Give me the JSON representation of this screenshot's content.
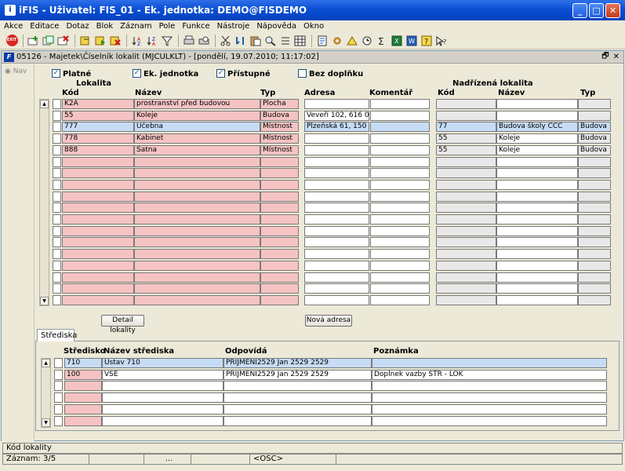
{
  "window": {
    "title": "iFIS - Uživatel: FIS_01 - Ek. jednotka: DEMO@FISDEMO",
    "icon_glyph": "i",
    "minimize": "_",
    "maximize": "□",
    "close": "✕"
  },
  "menu": [
    "Akce",
    "Editace",
    "Dotaz",
    "Blok",
    "Záznam",
    "Pole",
    "Funkce",
    "Nástroje",
    "Nápověda",
    "Okno"
  ],
  "toolbar": {
    "exit_label": "EXIT"
  },
  "form": {
    "title": "05126 - Majetek\\Číselník lokalit (MJCULKLT) - [pondělí, 19.07.2010; 11:17:02]",
    "icon_glyph": "F",
    "restore": "🗗",
    "close": "✕"
  },
  "nav": {
    "label": "Nav"
  },
  "filters": {
    "platne": "Platné",
    "ek_jednotka": "Ek. jednotka",
    "pristupne": "Přístupné",
    "bez_doplnku": "Bez doplňku",
    "check": "✓"
  },
  "headers": {
    "lokalita": "Lokalita",
    "kod": "Kód",
    "nazev": "Název",
    "typ": "Typ",
    "adresa": "Adresa",
    "komentar": "Komentář",
    "nadrizena": "Nadřízená lokalita",
    "n_kod": "Kód",
    "n_nazev": "Název",
    "n_typ": "Typ"
  },
  "lokality": [
    {
      "kod": "K2A",
      "nazev": "prostranství před budovou",
      "typ": "Plocha",
      "adresa": "",
      "komentar": "",
      "n_kod": "",
      "n_nazev": "",
      "n_typ": ""
    },
    {
      "kod": "55",
      "nazev": "Koleje",
      "typ": "Budova",
      "adresa": "Veveří 102, 616 00 Br",
      "komentar": "",
      "n_kod": "",
      "n_nazev": "",
      "n_typ": ""
    },
    {
      "kod": "777",
      "nazev": "Učebna",
      "typ": "Místnost",
      "adresa": "Plzeňská 61, 150 07 P",
      "komentar": "",
      "n_kod": "77",
      "n_nazev": "Budova školy CCC",
      "n_typ": "Budova"
    },
    {
      "kod": "778",
      "nazev": "Kabinet",
      "typ": "Místnost",
      "adresa": "",
      "komentar": "",
      "n_kod": "55",
      "n_nazev": "Koleje",
      "n_typ": "Budova"
    },
    {
      "kod": "888",
      "nazev": "Šatna",
      "typ": "Místnost",
      "adresa": "",
      "komentar": "",
      "n_kod": "55",
      "n_nazev": "Koleje",
      "n_typ": "Budova"
    }
  ],
  "buttons": {
    "detail": "Detail lokality",
    "nova_adresa": "Nová adresa"
  },
  "tab": {
    "label": "Střediska"
  },
  "strediska_headers": {
    "stredisko": "Středisko",
    "nazev": "Název střediska",
    "odpovida": "Odpovídá",
    "poznamka": "Poznámka"
  },
  "strediska": [
    {
      "stredisko": "710",
      "nazev": "Ústav 710",
      "odpovida": "PRIJMENI2529 Jan 2529 2529",
      "poznamka": ""
    },
    {
      "stredisko": "100",
      "nazev": "VSE",
      "odpovida": "PRIJMENI2529 Jan 2529 2529",
      "poznamka": "Doplnek vazby STR - LOK"
    }
  ],
  "status": {
    "field": "Kód lokality",
    "record": "Záznam: 3/5",
    "dots": "...",
    "osc": "<OSC>"
  },
  "scroll": {
    "up": "▲",
    "down": "▼"
  }
}
